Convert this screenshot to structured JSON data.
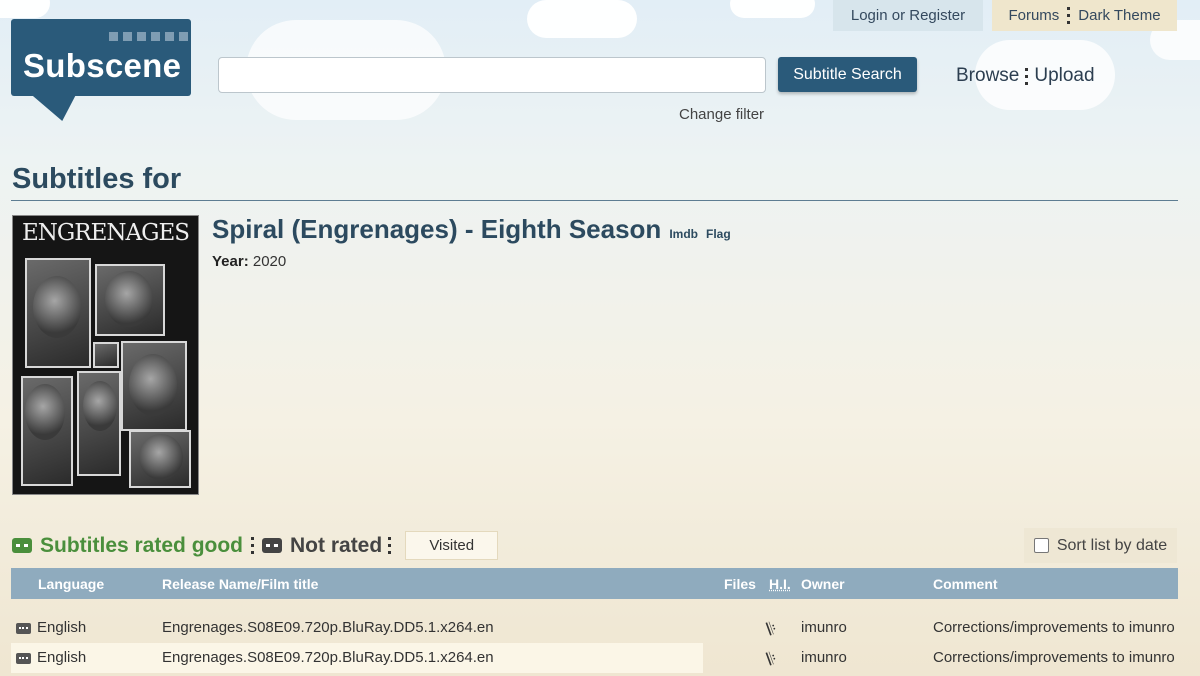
{
  "header": {
    "logo_text": "Subscene",
    "login_label": "Login or Register",
    "forums_label": "Forums",
    "dark_theme_label": "Dark Theme",
    "search_placeholder": "",
    "search_button": "Subtitle Search",
    "change_filter": "Change filter",
    "browse": "Browse",
    "upload": "Upload"
  },
  "page": {
    "heading": "Subtitles for",
    "title": "Spiral (Engrenages) - Eighth Season",
    "imdb_label": "Imdb",
    "flag_label": "Flag",
    "year_label": "Year:",
    "year_value": "2020",
    "poster_title": "ENGRENAGES"
  },
  "filters": {
    "rated_good": "Subtitles rated good",
    "not_rated": "Not rated",
    "visited": "Visited",
    "sort_by_date": "Sort list by date"
  },
  "table": {
    "columns": [
      "Language",
      "Release Name/Film title",
      "Files",
      "H.I.",
      "Owner",
      "Comment"
    ],
    "rows": [
      {
        "language": "English",
        "release": "Engrenages.S08E09.720p.BluRay.DD5.1.x264.en",
        "files": "",
        "owner": "imunro",
        "comment": "Corrections/improvements to imunro"
      },
      {
        "language": "English",
        "release": "Engrenages.S08E09.720p.BluRay.DD5.1.x264.en",
        "files": "",
        "owner": "imunro",
        "comment": "Corrections/improvements to imunro"
      }
    ]
  },
  "colors": {
    "brand": "#2a5a7a",
    "good": "#4a8f3c",
    "table_header": "#8fabbe"
  },
  "icons": {
    "rating": "speech-bubble-icon",
    "hearing_impaired": "ear-icon"
  }
}
